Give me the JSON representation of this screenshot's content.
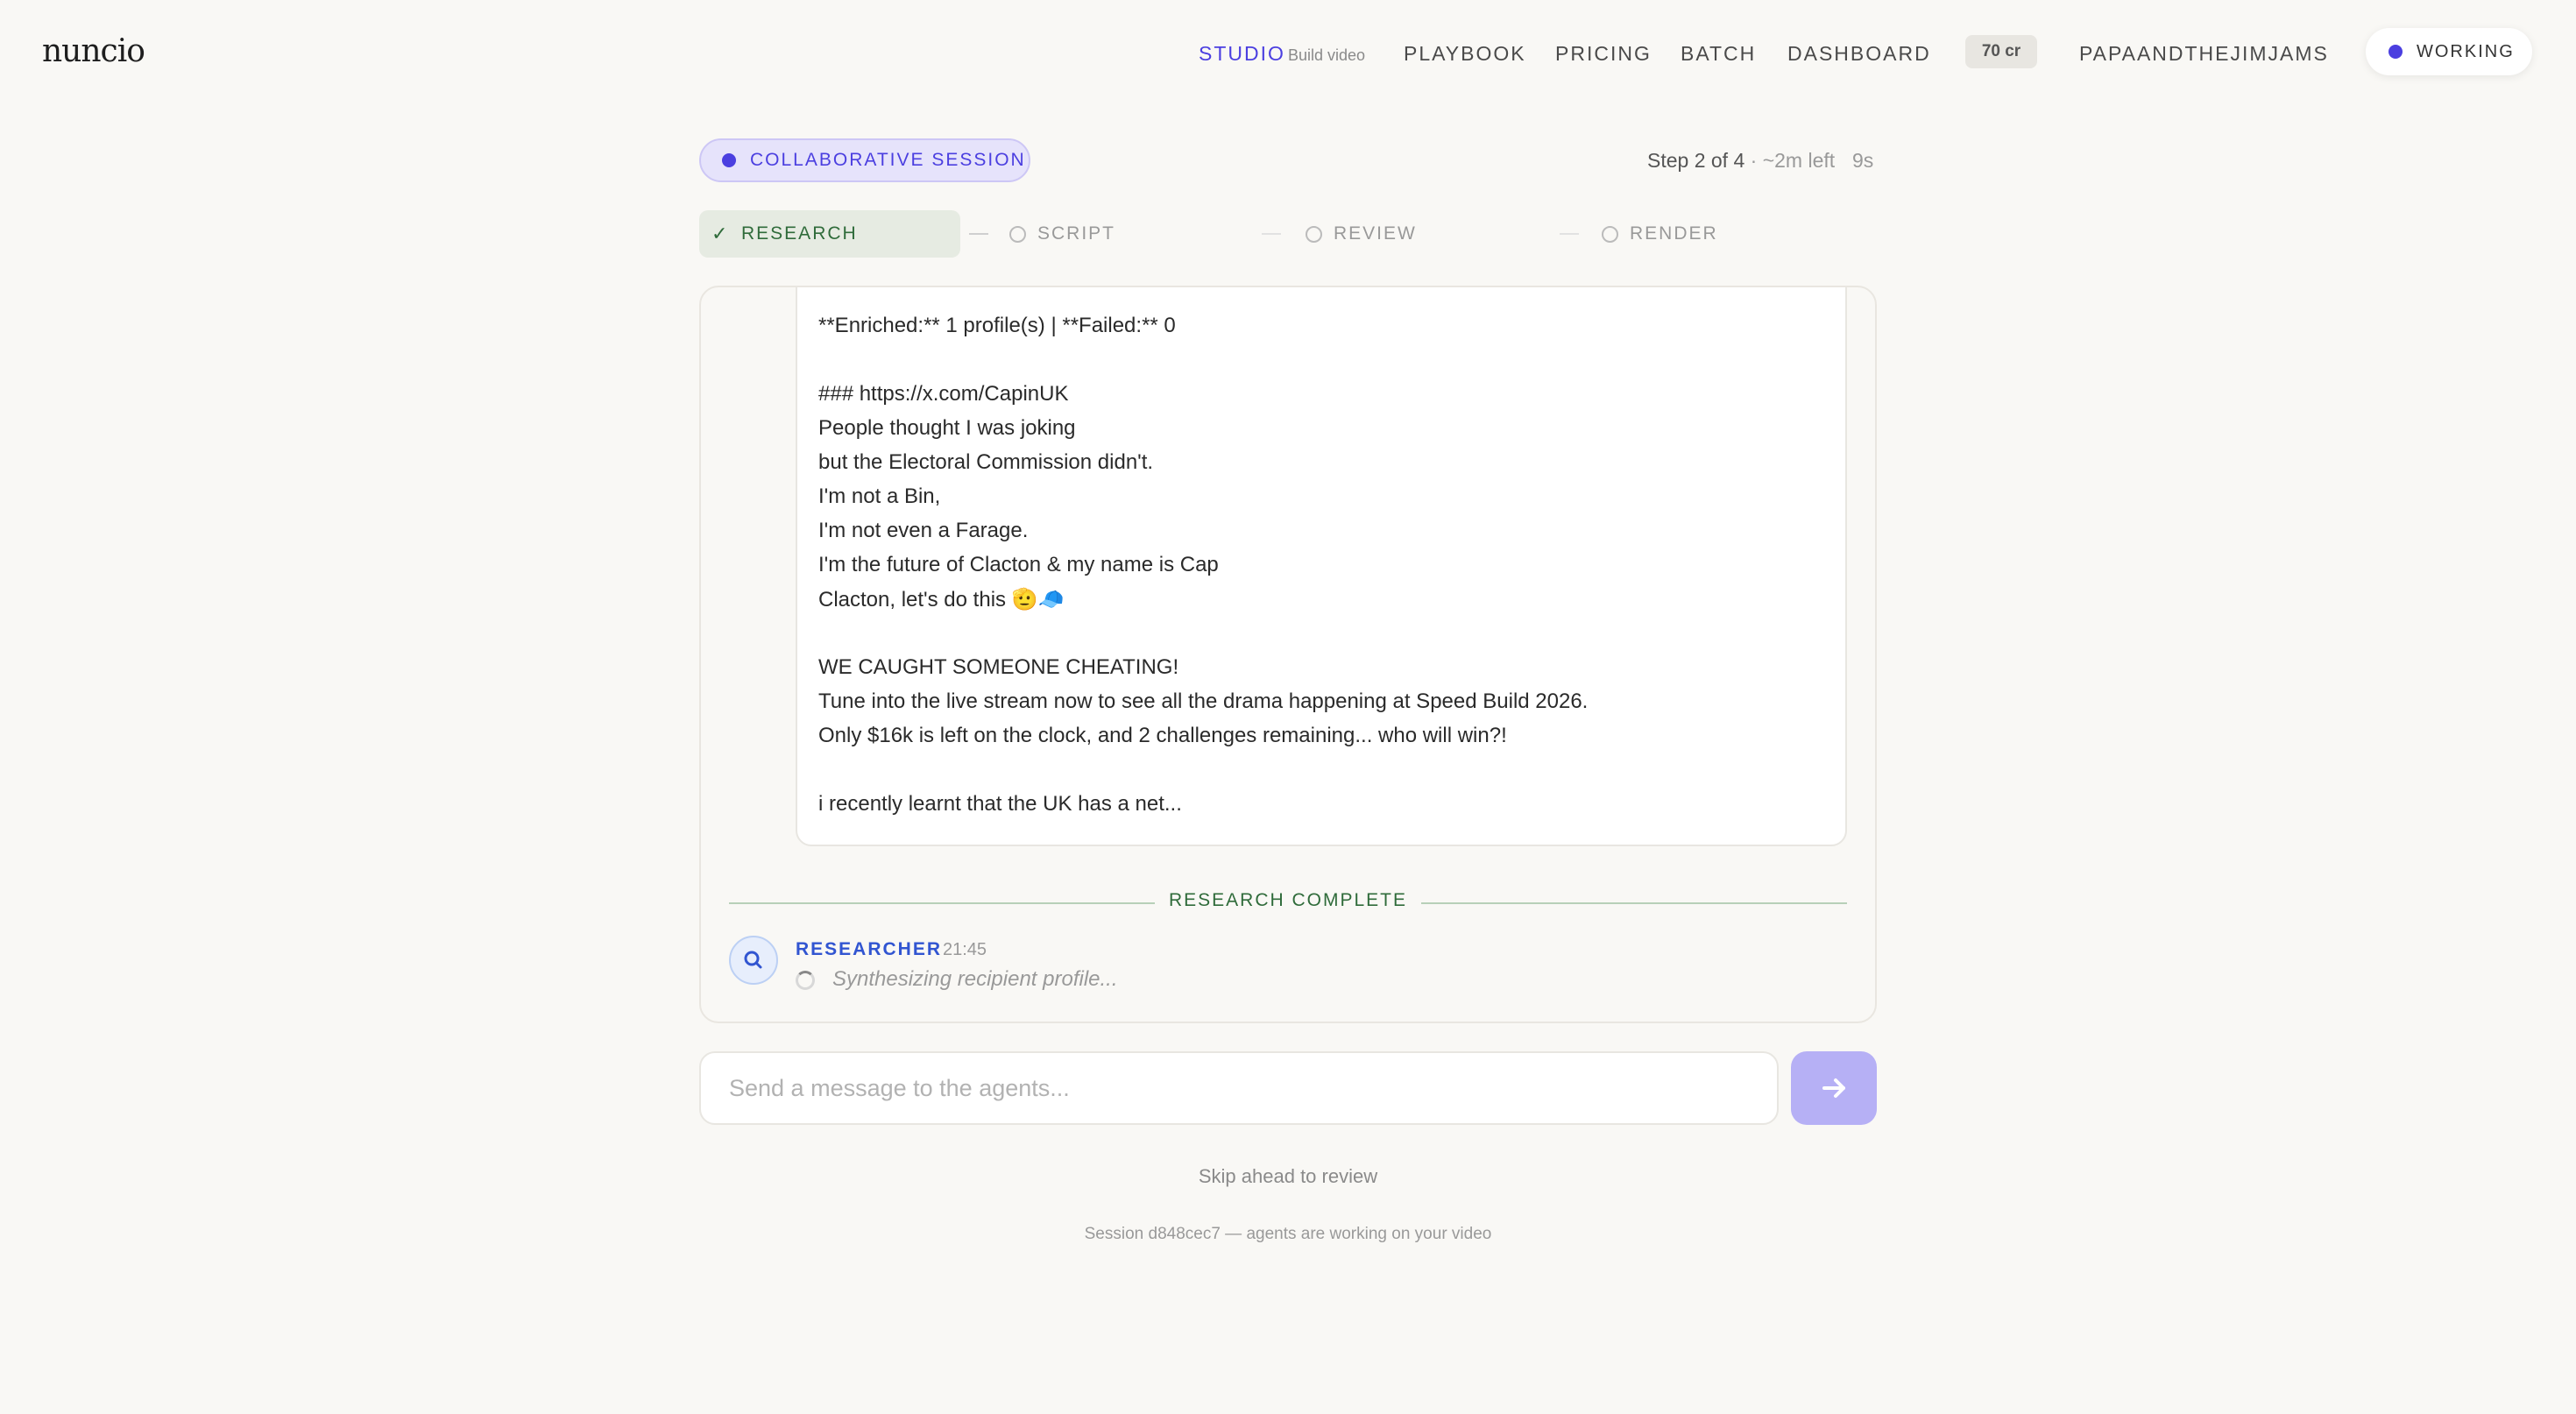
{
  "header": {
    "logo": "nuncio",
    "nav": {
      "studio": "STUDIO",
      "studio_sub": "Build video",
      "playbook": "PLAYBOOK",
      "pricing": "PRICING",
      "batch": "BATCH",
      "dashboard": "DASHBOARD",
      "credits": "70 cr",
      "user": "PAPAANDTHEJIMJAMS"
    },
    "status": "WORKING"
  },
  "session": {
    "label": "COLLABORATIVE SESSION",
    "step": "Step 2 of 4",
    "eta": "· ~2m left",
    "timer": "9s"
  },
  "stepper": {
    "steps": [
      {
        "label": "RESEARCH",
        "state": "done"
      },
      {
        "label": "SCRIPT",
        "state": "pending"
      },
      {
        "label": "REVIEW",
        "state": "pending"
      },
      {
        "label": "RENDER",
        "state": "pending"
      }
    ]
  },
  "message": {
    "lines": [
      "**Enriched:** 1 profile(s) | **Failed:** 0",
      "### https://x.com/CapinUK",
      "People thought I was joking",
      "but the Electoral Commission didn't.",
      "I'm not a Bin,",
      "I'm not even a Farage.",
      "I'm the future of Clacton & my name is Cap",
      "Clacton, let's do this 🫡🧢",
      "WE CAUGHT SOMEONE CHEATING!",
      "Tune into the live stream now to see all the drama happening at Speed Build 2026.",
      "Only $16k is left on the clock, and 2 challenges remaining... who will win?!",
      "i recently learnt that the UK has a net..."
    ]
  },
  "divider": "RESEARCH COMPLETE",
  "agent": {
    "name": "RESEARCHER",
    "time": "21:45",
    "status": "Synthesizing recipient profile..."
  },
  "composer": {
    "placeholder": "Send a message to the agents..."
  },
  "skip": "Skip ahead to review",
  "footer": "Session d848cec7 — agents are working on your video",
  "colors": {
    "accent": "#4b3fe0",
    "success": "#2f6b3a",
    "agent": "#3155d1",
    "send": "#b6b0f5"
  }
}
